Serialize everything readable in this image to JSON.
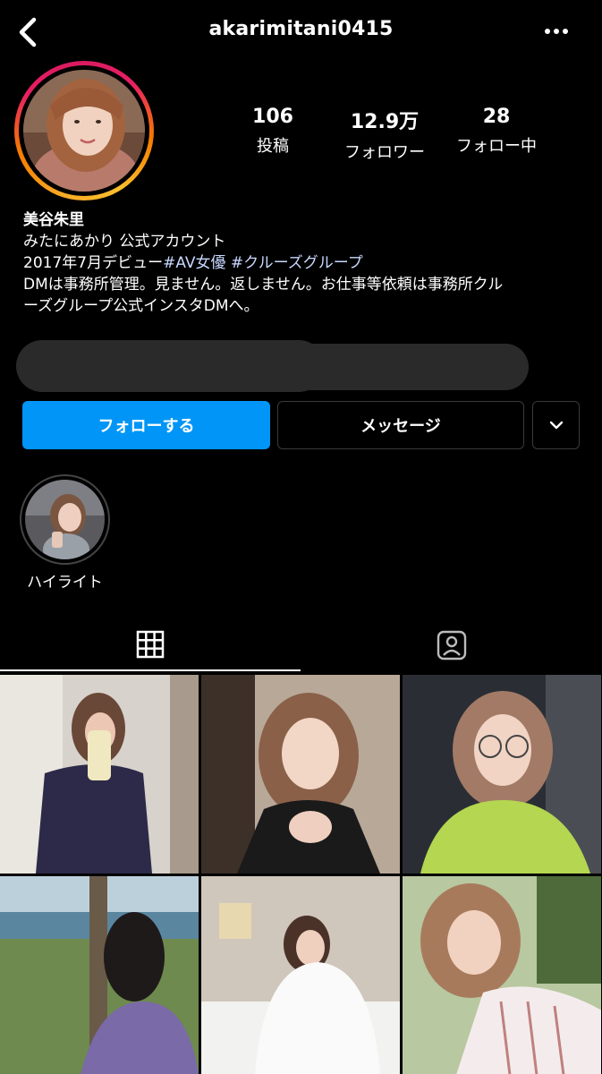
{
  "header": {
    "username": "akarimitani0415",
    "back_icon": "chevron-left-icon",
    "more_icon": "more-horizontal-icon"
  },
  "profile": {
    "stats": [
      {
        "value": "106",
        "label": "投稿"
      },
      {
        "value": "12.9万",
        "label": "フォロワー"
      },
      {
        "value": "28",
        "label": "フォロー中"
      }
    ],
    "name": "美谷朱里",
    "bio_line1": "みたにあかり 公式アカウント",
    "bio_line2_prefix": "2017年7月デビュー",
    "bio_hashtag1": "#AV女優",
    "bio_hashtag2": "#クルーズグループ",
    "bio_line3": "DMは事務所管理。見ません。返しません。お仕事等依頼は事務所クル",
    "bio_line4": "ーズグループ公式インスタDMへ。"
  },
  "actions": {
    "follow_label": "フォローする",
    "message_label": "メッセージ",
    "more_icon": "chevron-down-icon"
  },
  "highlights": [
    {
      "label": "ハイライト"
    }
  ],
  "tabs": [
    {
      "icon": "grid-icon",
      "active": true
    },
    {
      "icon": "tagged-person-icon",
      "active": false
    }
  ],
  "colors": {
    "accent": "#0095f6",
    "background": "#000000",
    "hashtag": "#c8d8ff"
  }
}
